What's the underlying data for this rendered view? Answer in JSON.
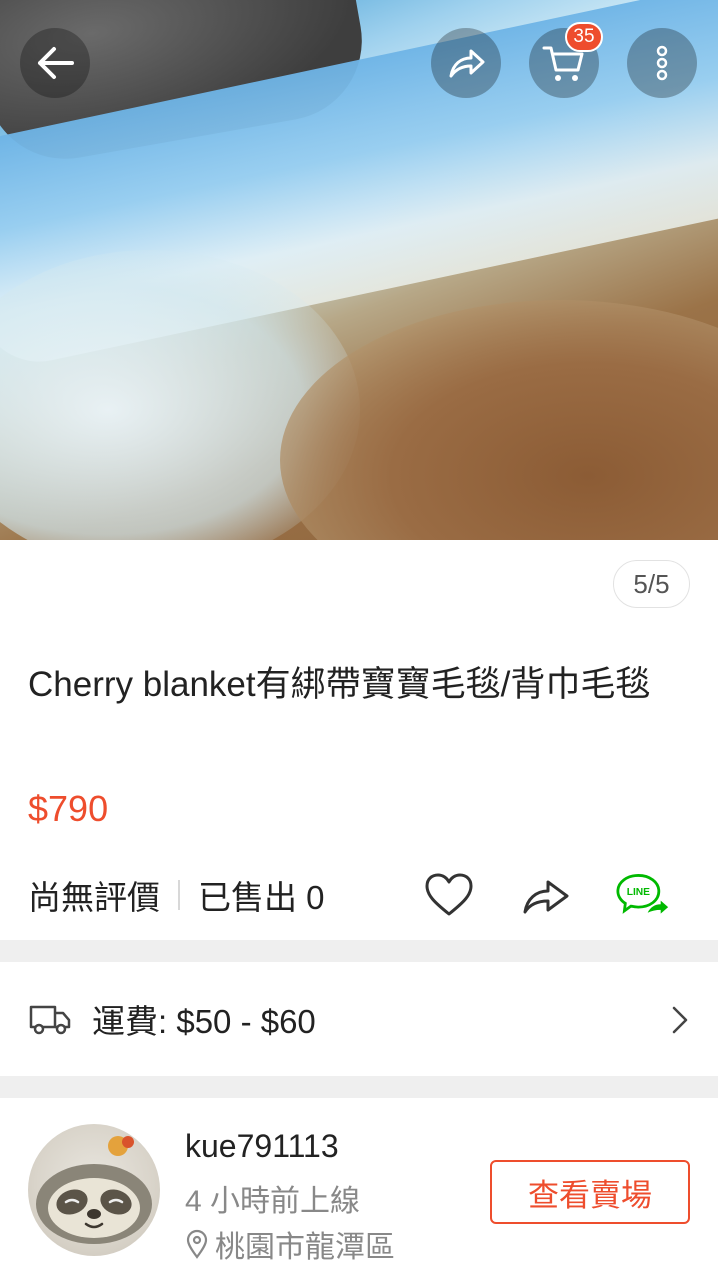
{
  "gallery": {
    "counter": "5/5",
    "cart_count": "35"
  },
  "product": {
    "title": "Cherry blanket有綁帶寶寶毛毯/背巾毛毯",
    "price": "$790",
    "rating_text": "尚無評價",
    "sold_text": "已售出 0"
  },
  "shipping": {
    "label": "運費: $50 - $60"
  },
  "seller": {
    "name": "kue791113",
    "online": "4 小時前上線",
    "location": "桃園市龍潭區",
    "shop_button": "查看賣場"
  },
  "icons": {
    "back": "arrow-left-icon",
    "share_top": "share-icon",
    "cart": "cart-icon",
    "more": "more-vertical-icon",
    "like": "heart-icon",
    "share": "share-icon",
    "line": "line-share-icon",
    "truck": "truck-icon",
    "chevron": "chevron-right-icon",
    "location": "location-pin-icon"
  },
  "colors": {
    "accent": "#ee4d2d",
    "line_green": "#00b900"
  }
}
